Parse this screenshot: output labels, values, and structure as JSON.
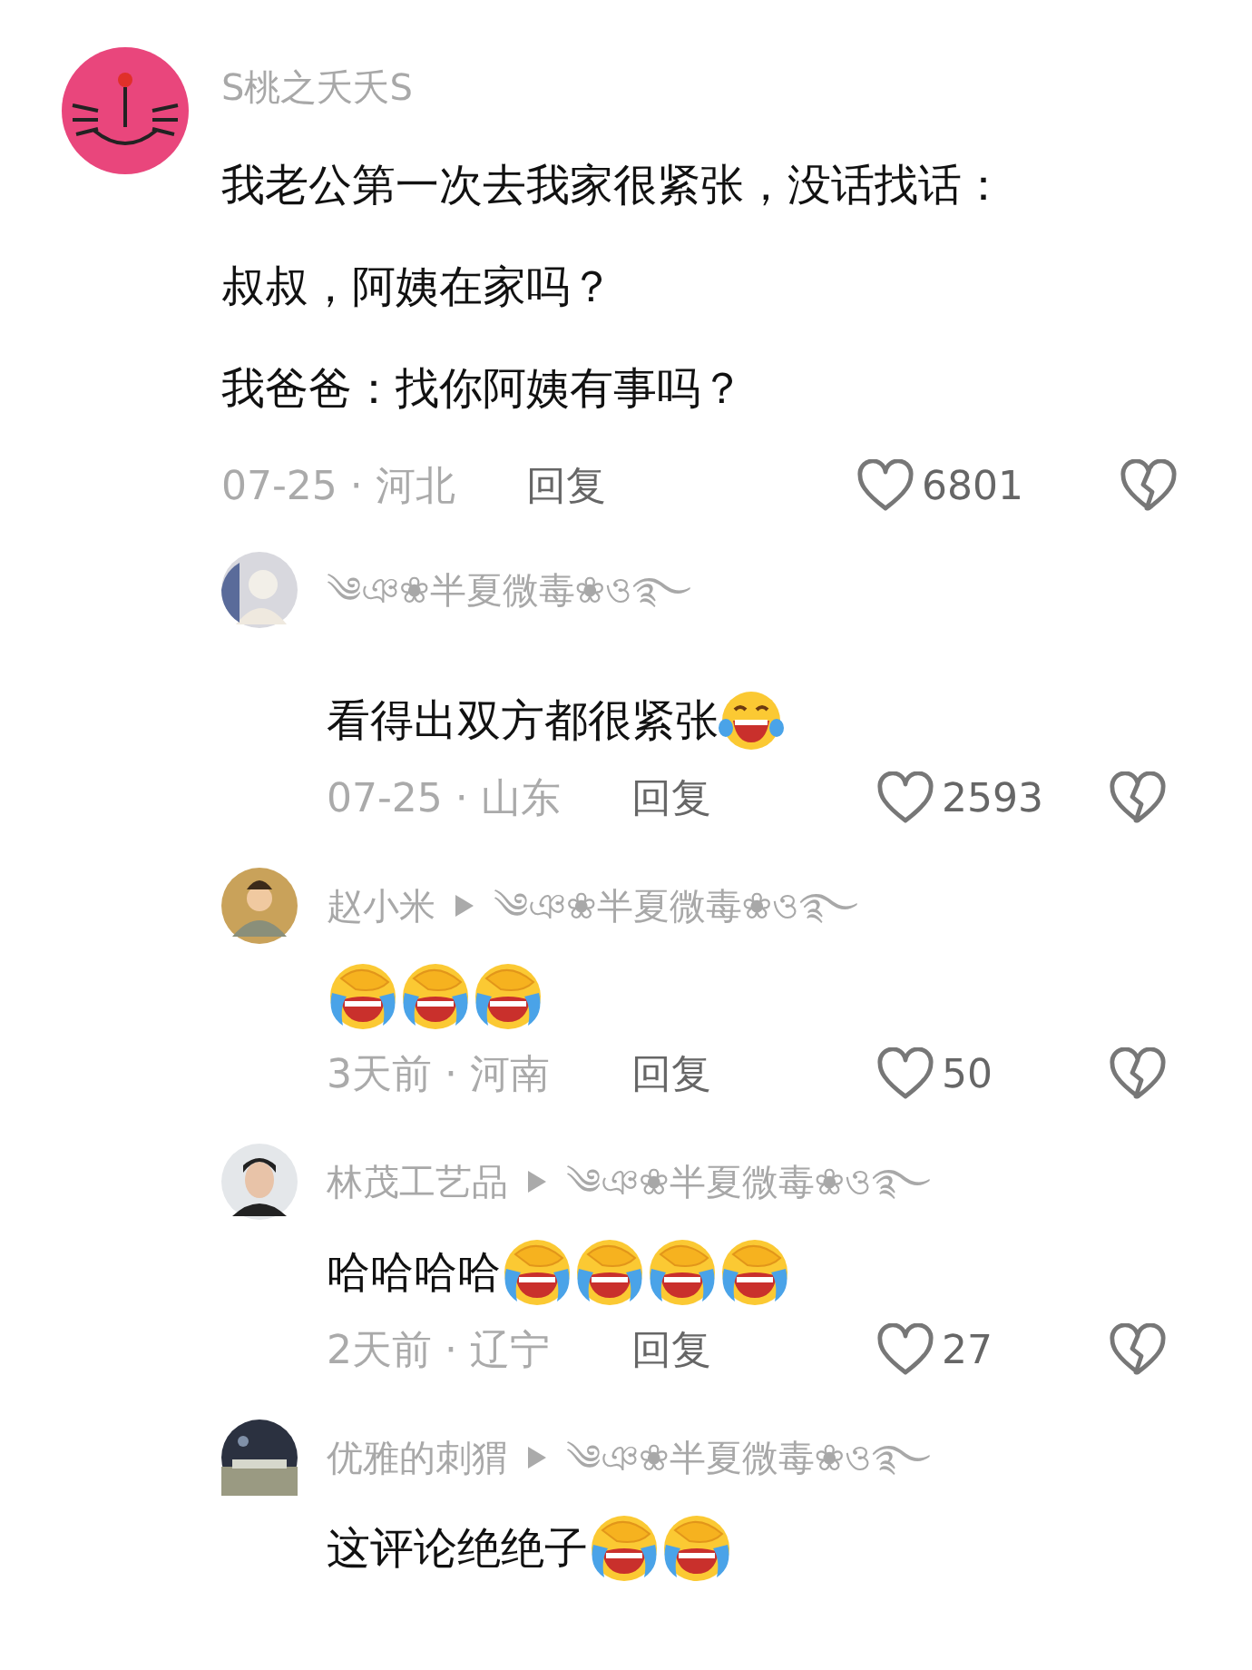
{
  "comment": {
    "author": "S桃之夭夭S",
    "lines": [
      "我老公第一次去我家很紧张，没话找话：",
      "叔叔，阿姨在家吗？",
      "我爸爸：找你阿姨有事吗？"
    ],
    "meta": "07-25 · 河北",
    "reply_label": "回复",
    "likes": "6801"
  },
  "replies": [
    {
      "author": "༄ঞ❀半夏微毒❀ও࿐",
      "text": "看得出双方都很紧张",
      "emojis": [
        {
          "kind": "joy"
        }
      ],
      "meta": "07-25 · 山东",
      "reply_label": "回复",
      "likes": "2593"
    },
    {
      "author": "赵小米",
      "reply_to": "༄ঞ❀半夏微毒❀ও࿐",
      "emojis": [
        {
          "kind": "facepalm"
        },
        {
          "kind": "facepalm"
        },
        {
          "kind": "facepalm"
        }
      ],
      "meta": "3天前 · 河南",
      "reply_label": "回复",
      "likes": "50"
    },
    {
      "author": "林茂工艺品",
      "reply_to": "༄ঞ❀半夏微毒❀ও࿐",
      "text": "哈哈哈哈",
      "emojis": [
        {
          "kind": "facepalm"
        },
        {
          "kind": "facepalm"
        },
        {
          "kind": "facepalm"
        },
        {
          "kind": "facepalm"
        }
      ],
      "meta": "2天前 · 辽宁",
      "reply_label": "回复",
      "likes": "27"
    },
    {
      "author": "优雅的刺猬",
      "reply_to": "༄ঞ❀半夏微毒❀ও࿐",
      "text": "这评论绝绝子",
      "emojis": [
        {
          "kind": "facepalm"
        },
        {
          "kind": "facepalm"
        }
      ]
    }
  ]
}
